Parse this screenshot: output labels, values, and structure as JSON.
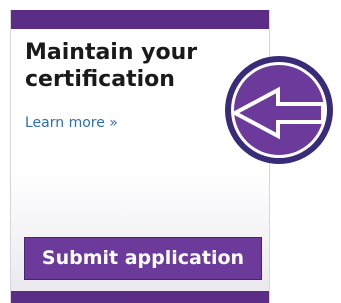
{
  "card": {
    "heading": "Maintain your certification",
    "learn_more": "Learn more »",
    "submit_label": "Submit application"
  },
  "badge": {
    "icon": "left-arrow-icon"
  },
  "colors": {
    "brand_purple": "#5b2d86",
    "button_purple": "#6b3a9a",
    "badge_outer": "#3a2b78",
    "badge_inner": "#6b3a9a",
    "link_blue": "#2f6fb0"
  }
}
